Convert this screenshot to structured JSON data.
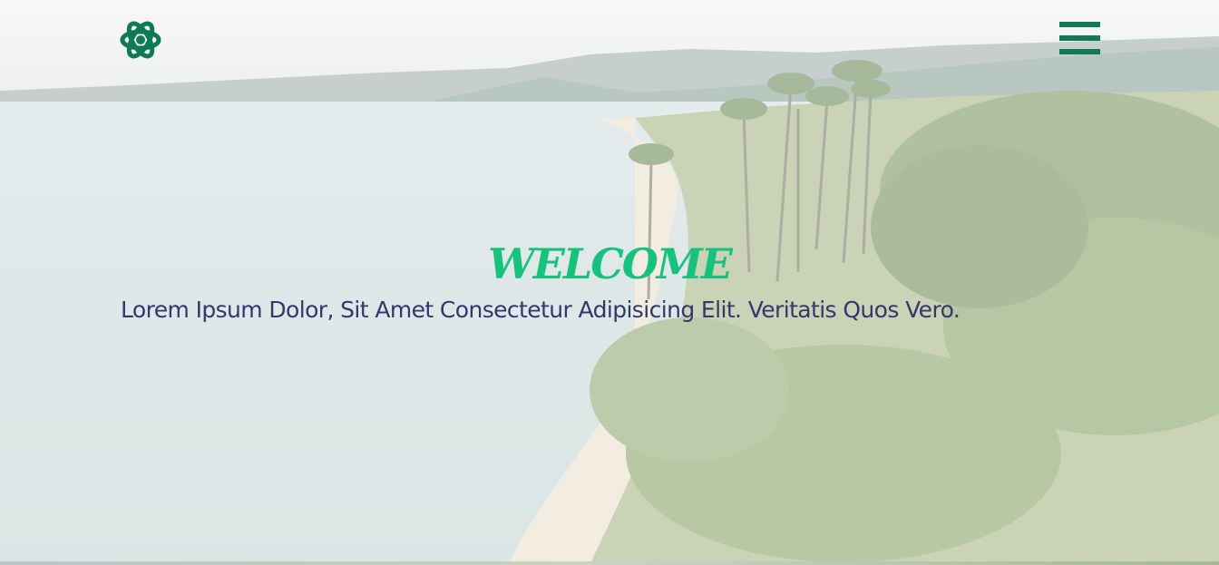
{
  "header": {
    "logo_icon": "atom-icon",
    "menu_icon": "hamburger-menu-icon"
  },
  "hero": {
    "title": "WELCOME",
    "subtitle": "Lorem Ipsum Dolor, Sit Amet Consectetur Adipisicing Elit. Veritatis Quos Vero."
  },
  "colors": {
    "accent": "#0f7a53",
    "title": "#16c27e",
    "subtitle": "#34386b"
  }
}
